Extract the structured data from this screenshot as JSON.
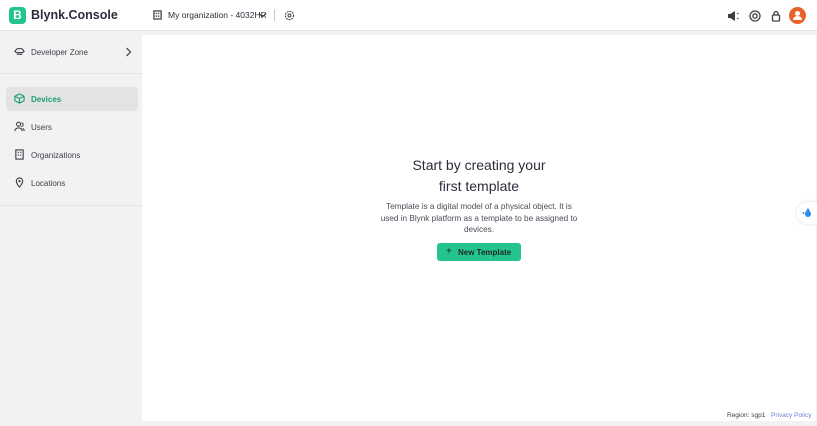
{
  "app": {
    "logo_letter": "B",
    "title": "Blynk.Console"
  },
  "header": {
    "org_name": "My organization - 4032HR",
    "icons": [
      "megaphone-icon",
      "help-icon",
      "lock-icon",
      "user-avatar"
    ]
  },
  "sidebar": {
    "developer_zone": "Developer Zone",
    "items": [
      {
        "label": "Devices",
        "icon": "cube-icon",
        "active": true
      },
      {
        "label": "Users",
        "icon": "users-icon",
        "active": false
      },
      {
        "label": "Organizations",
        "icon": "building-icon",
        "active": false
      },
      {
        "label": "Locations",
        "icon": "location-pin-icon",
        "active": false
      }
    ]
  },
  "main": {
    "title_line1": "Start by creating your",
    "title_line2": "first template",
    "description": "Template is a digital model of a physical object. It is used in Blynk platform as a template to be assigned to devices.",
    "button_label": "New Template"
  },
  "footer": {
    "region": "Region: sgp1",
    "privacy": "Privacy Policy"
  },
  "colors": {
    "accent": "#23c48e",
    "active_text": "#1a9f6f",
    "avatar": "#e8622b",
    "link": "#6b7fd6"
  }
}
